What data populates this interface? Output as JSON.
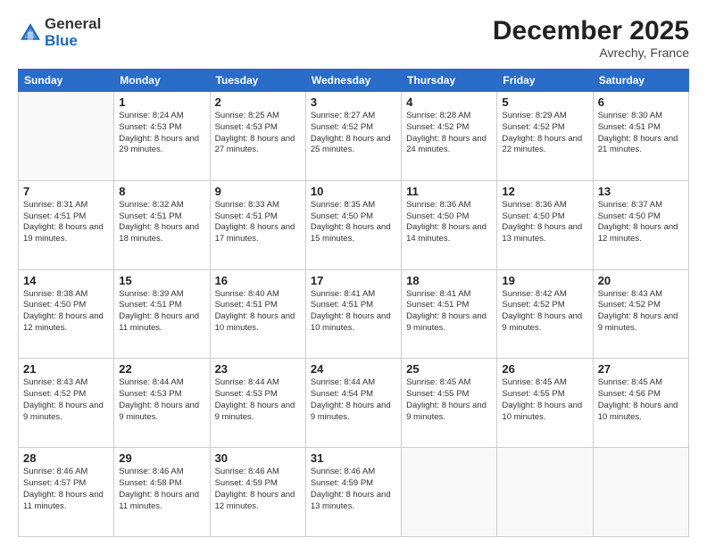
{
  "header": {
    "logo_general": "General",
    "logo_blue": "Blue",
    "month_title": "December 2025",
    "location": "Avrechy, France"
  },
  "weekdays": [
    "Sunday",
    "Monday",
    "Tuesday",
    "Wednesday",
    "Thursday",
    "Friday",
    "Saturday"
  ],
  "weeks": [
    [
      {
        "day": "",
        "info": ""
      },
      {
        "day": "1",
        "info": "Sunrise: 8:24 AM\nSunset: 4:53 PM\nDaylight: 8 hours\nand 29 minutes."
      },
      {
        "day": "2",
        "info": "Sunrise: 8:25 AM\nSunset: 4:53 PM\nDaylight: 8 hours\nand 27 minutes."
      },
      {
        "day": "3",
        "info": "Sunrise: 8:27 AM\nSunset: 4:52 PM\nDaylight: 8 hours\nand 25 minutes."
      },
      {
        "day": "4",
        "info": "Sunrise: 8:28 AM\nSunset: 4:52 PM\nDaylight: 8 hours\nand 24 minutes."
      },
      {
        "day": "5",
        "info": "Sunrise: 8:29 AM\nSunset: 4:52 PM\nDaylight: 8 hours\nand 22 minutes."
      },
      {
        "day": "6",
        "info": "Sunrise: 8:30 AM\nSunset: 4:51 PM\nDaylight: 8 hours\nand 21 minutes."
      }
    ],
    [
      {
        "day": "7",
        "info": "Sunrise: 8:31 AM\nSunset: 4:51 PM\nDaylight: 8 hours\nand 19 minutes."
      },
      {
        "day": "8",
        "info": "Sunrise: 8:32 AM\nSunset: 4:51 PM\nDaylight: 8 hours\nand 18 minutes."
      },
      {
        "day": "9",
        "info": "Sunrise: 8:33 AM\nSunset: 4:51 PM\nDaylight: 8 hours\nand 17 minutes."
      },
      {
        "day": "10",
        "info": "Sunrise: 8:35 AM\nSunset: 4:50 PM\nDaylight: 8 hours\nand 15 minutes."
      },
      {
        "day": "11",
        "info": "Sunrise: 8:36 AM\nSunset: 4:50 PM\nDaylight: 8 hours\nand 14 minutes."
      },
      {
        "day": "12",
        "info": "Sunrise: 8:36 AM\nSunset: 4:50 PM\nDaylight: 8 hours\nand 13 minutes."
      },
      {
        "day": "13",
        "info": "Sunrise: 8:37 AM\nSunset: 4:50 PM\nDaylight: 8 hours\nand 12 minutes."
      }
    ],
    [
      {
        "day": "14",
        "info": "Sunrise: 8:38 AM\nSunset: 4:50 PM\nDaylight: 8 hours\nand 12 minutes."
      },
      {
        "day": "15",
        "info": "Sunrise: 8:39 AM\nSunset: 4:51 PM\nDaylight: 8 hours\nand 11 minutes."
      },
      {
        "day": "16",
        "info": "Sunrise: 8:40 AM\nSunset: 4:51 PM\nDaylight: 8 hours\nand 10 minutes."
      },
      {
        "day": "17",
        "info": "Sunrise: 8:41 AM\nSunset: 4:51 PM\nDaylight: 8 hours\nand 10 minutes."
      },
      {
        "day": "18",
        "info": "Sunrise: 8:41 AM\nSunset: 4:51 PM\nDaylight: 8 hours\nand 9 minutes."
      },
      {
        "day": "19",
        "info": "Sunrise: 8:42 AM\nSunset: 4:52 PM\nDaylight: 8 hours\nand 9 minutes."
      },
      {
        "day": "20",
        "info": "Sunrise: 8:43 AM\nSunset: 4:52 PM\nDaylight: 8 hours\nand 9 minutes."
      }
    ],
    [
      {
        "day": "21",
        "info": "Sunrise: 8:43 AM\nSunset: 4:52 PM\nDaylight: 8 hours\nand 9 minutes."
      },
      {
        "day": "22",
        "info": "Sunrise: 8:44 AM\nSunset: 4:53 PM\nDaylight: 8 hours\nand 9 minutes."
      },
      {
        "day": "23",
        "info": "Sunrise: 8:44 AM\nSunset: 4:53 PM\nDaylight: 8 hours\nand 9 minutes."
      },
      {
        "day": "24",
        "info": "Sunrise: 8:44 AM\nSunset: 4:54 PM\nDaylight: 8 hours\nand 9 minutes."
      },
      {
        "day": "25",
        "info": "Sunrise: 8:45 AM\nSunset: 4:55 PM\nDaylight: 8 hours\nand 9 minutes."
      },
      {
        "day": "26",
        "info": "Sunrise: 8:45 AM\nSunset: 4:55 PM\nDaylight: 8 hours\nand 10 minutes."
      },
      {
        "day": "27",
        "info": "Sunrise: 8:45 AM\nSunset: 4:56 PM\nDaylight: 8 hours\nand 10 minutes."
      }
    ],
    [
      {
        "day": "28",
        "info": "Sunrise: 8:46 AM\nSunset: 4:57 PM\nDaylight: 8 hours\nand 11 minutes."
      },
      {
        "day": "29",
        "info": "Sunrise: 8:46 AM\nSunset: 4:58 PM\nDaylight: 8 hours\nand 11 minutes."
      },
      {
        "day": "30",
        "info": "Sunrise: 8:46 AM\nSunset: 4:59 PM\nDaylight: 8 hours\nand 12 minutes."
      },
      {
        "day": "31",
        "info": "Sunrise: 8:46 AM\nSunset: 4:59 PM\nDaylight: 8 hours\nand 13 minutes."
      },
      {
        "day": "",
        "info": ""
      },
      {
        "day": "",
        "info": ""
      },
      {
        "day": "",
        "info": ""
      }
    ]
  ]
}
